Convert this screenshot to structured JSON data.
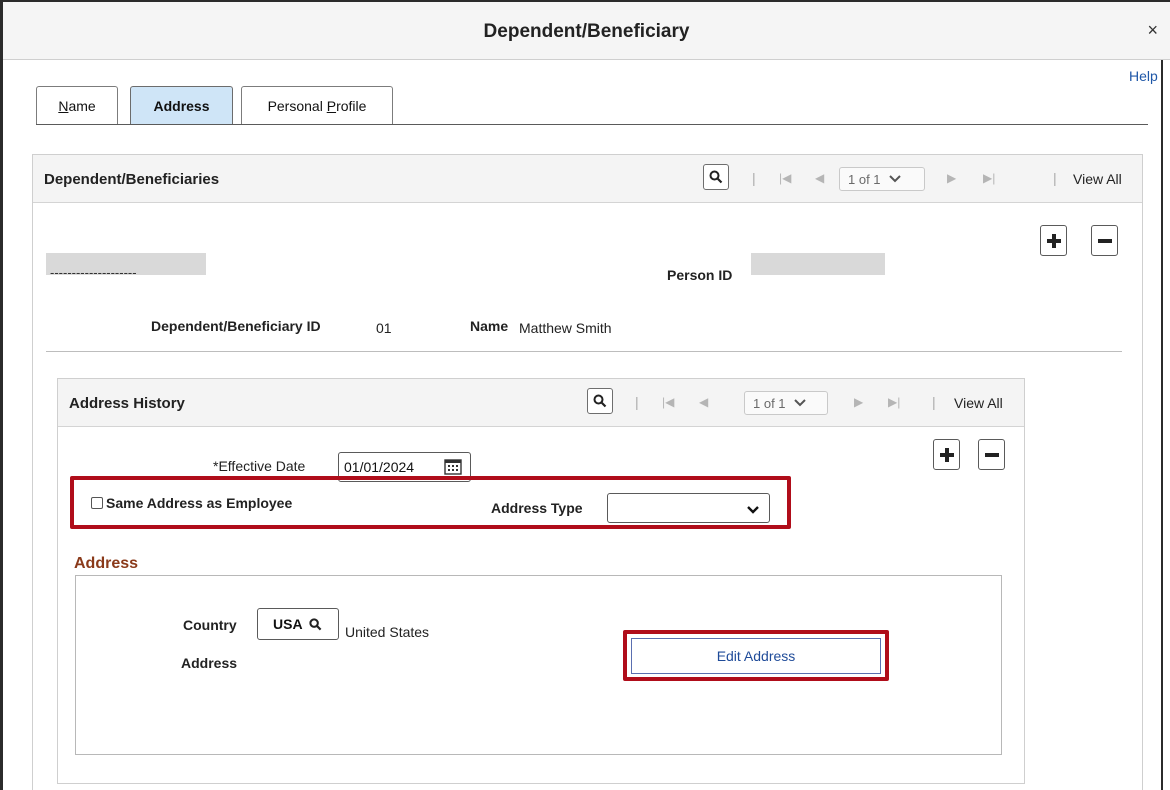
{
  "window": {
    "title": "Dependent/Beneficiary",
    "close_label": "×",
    "help_label": "Help"
  },
  "tabs": [
    {
      "label_pre": "",
      "label_accel": "N",
      "label_post": "ame",
      "active": false
    },
    {
      "label_pre": "",
      "label_accel": "",
      "label_post": "Address",
      "active": true
    },
    {
      "label_pre": "Personal ",
      "label_accel": "P",
      "label_post": "rofile",
      "active": false
    }
  ],
  "dependents_panel": {
    "title": "Dependent/Beneficiaries",
    "pager": "1 of 1",
    "view_all": "View All",
    "name_dashes": "--------------------",
    "person_id_label": "Person ID",
    "dep_id_label": "Dependent/Beneficiary ID",
    "dep_id_value": "01",
    "name_label": "Name",
    "name_value": "Matthew Smith"
  },
  "address_history": {
    "title": "Address History",
    "pager": "1 of 1",
    "view_all": "View All",
    "effective_date_label": "*Effective Date",
    "effective_date_value": "01/01/2024",
    "same_address_label": "Same Address as Employee",
    "same_address_checked": false,
    "address_type_label": "Address Type",
    "address_type_value": ""
  },
  "address_section": {
    "title": "Address",
    "country_label": "Country",
    "country_code": "USA",
    "country_name": "United States",
    "address_label": "Address",
    "edit_button": "Edit Address"
  },
  "colors": {
    "highlight_red": "#b00d1a",
    "active_tab": "#cfe5f7",
    "link_blue": "#1f57a8",
    "section_title": "#8a3a1a"
  }
}
